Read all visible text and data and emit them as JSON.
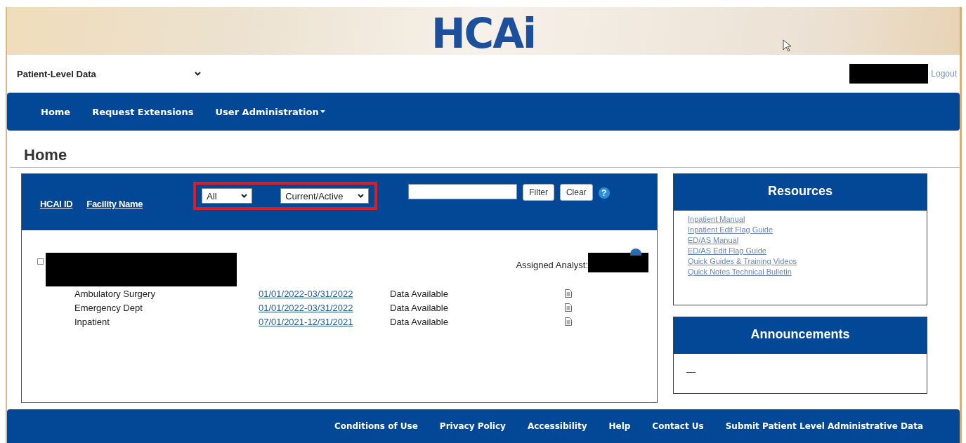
{
  "logo": {
    "text": "HCAi"
  },
  "program_select": {
    "value": "Patient-Level Data"
  },
  "user": {
    "logout": "Logout"
  },
  "nav": [
    {
      "label": "Home",
      "dropdown": false
    },
    {
      "label": "Request Extensions",
      "dropdown": false
    },
    {
      "label": "User Administration",
      "dropdown": true
    }
  ],
  "page_title": "Home",
  "facility_panel": {
    "sort_links": [
      "HCAI ID",
      "Facility Name"
    ],
    "filters": [
      {
        "value": "All"
      },
      {
        "value": "Current/Active"
      }
    ],
    "search": {
      "kind": "text"
    },
    "buttons": [
      "Filter",
      "Clear"
    ],
    "help": "?",
    "assigned_analyst_label": "Assigned Analyst:",
    "rows": [
      {
        "data_type": "Ambulatory Surgery",
        "period": "01/01/2022-03/31/2022",
        "status": "Data Available"
      },
      {
        "data_type": "Emergency Dept",
        "period": "01/01/2022-03/31/2022",
        "status": "Data Available"
      },
      {
        "data_type": "Inpatient",
        "period": "07/01/2021-12/31/2021",
        "status": "Data Available"
      }
    ]
  },
  "resources": {
    "title": "Resources",
    "links": [
      "Inpatient Manual",
      "Inpatient Edit Flag Guide",
      "ED/AS Manual",
      "ED/AS Edit Flag Guide",
      "Quick Guides & Training Videos",
      "Quick Notes Technical Bulletin"
    ]
  },
  "announcements": {
    "title": "Announcements",
    "items": [
      "—"
    ]
  },
  "footer": [
    "Conditions of Use",
    "Privacy Policy",
    "Accessibility",
    "Help",
    "Contact Us",
    "Submit Patient Level Administrative Data"
  ]
}
